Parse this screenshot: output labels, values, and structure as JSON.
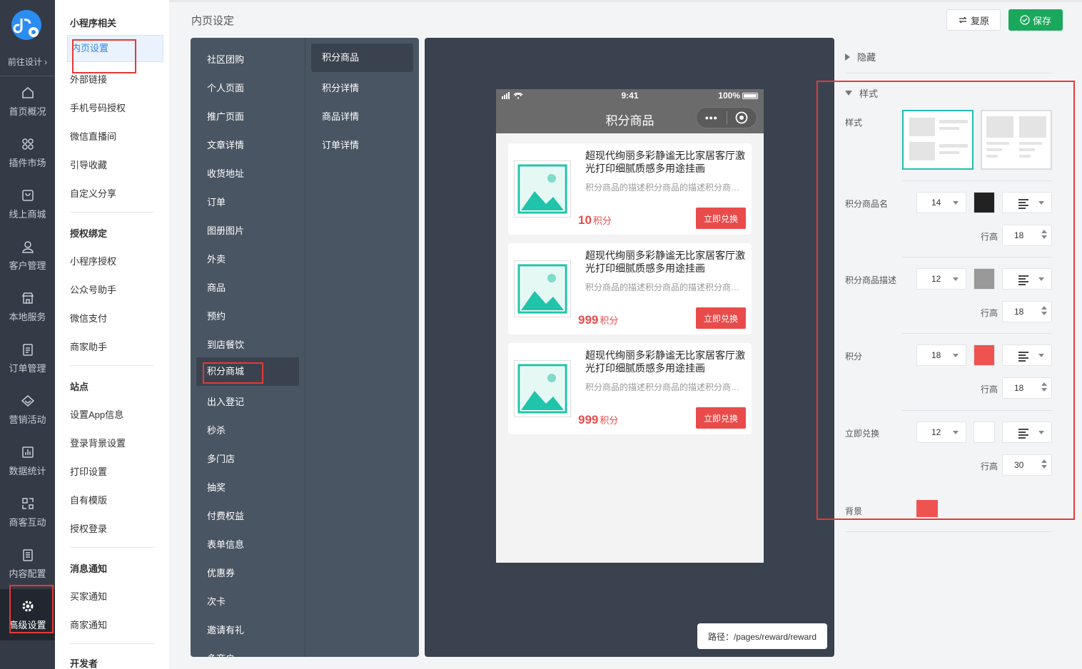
{
  "rail": {
    "design_link": "前往设计 ›",
    "items": [
      {
        "label": "首页概况",
        "icon": "home-icon"
      },
      {
        "label": "插件市场",
        "icon": "grid-icon"
      },
      {
        "label": "线上商城",
        "icon": "bag-icon"
      },
      {
        "label": "客户管理",
        "icon": "user-icon"
      },
      {
        "label": "本地服务",
        "icon": "store-icon"
      },
      {
        "label": "订单管理",
        "icon": "clipboard-icon"
      },
      {
        "label": "营销活动",
        "icon": "diamond-icon"
      },
      {
        "label": "数据统计",
        "icon": "chart-icon"
      },
      {
        "label": "商客互动",
        "icon": "interact-icon"
      },
      {
        "label": "内容配置",
        "icon": "document-icon"
      },
      {
        "label": "高级设置",
        "icon": "gear-icon",
        "active": true
      }
    ]
  },
  "menu": {
    "groups": [
      {
        "title": "小程序相关",
        "items": [
          "内页设置",
          "外部链接",
          "手机号码授权",
          "微信直播间",
          "引导收藏",
          "自定义分享"
        ]
      },
      {
        "title": "授权绑定",
        "items": [
          "小程序授权",
          "公众号助手",
          "微信支付",
          "商家助手"
        ]
      },
      {
        "title": "站点",
        "items": [
          "设置App信息",
          "登录背景设置",
          "打印设置",
          "自有模版",
          "授权登录"
        ]
      },
      {
        "title": "消息通知",
        "items": [
          "买家通知",
          "商家通知"
        ]
      },
      {
        "title": "开发者",
        "items": []
      }
    ]
  },
  "header": {
    "title": "内页设定",
    "restore_label": "复原",
    "save_label": "保存"
  },
  "pages": {
    "categories": [
      "社区团购",
      "个人页面",
      "推广页面",
      "文章详情",
      "收货地址",
      "订单",
      "图册图片",
      "外卖",
      "商品",
      "预约",
      "到店餐饮",
      "积分商城",
      "出入登记",
      "秒杀",
      "多门店",
      "抽奖",
      "付费权益",
      "表单信息",
      "优惠券",
      "次卡",
      "邀请有礼",
      "多商户"
    ],
    "active_category": "积分商城",
    "subpages": [
      "积分商品",
      "积分详情",
      "商品详情",
      "订单详情"
    ],
    "active_subpage": "积分商品"
  },
  "preview": {
    "status_time": "9:41",
    "status_battery": "100%",
    "nav_title": "积分商品",
    "capsule_dots": "•••",
    "products": [
      {
        "name": "超现代绚丽多彩静谧无比家居客厅激光打印细腻质感多用途挂画",
        "desc": "积分商品的描述积分商品的描述积分商品的描述",
        "price": "10",
        "unit": "积分",
        "button": "立即兑换"
      },
      {
        "name": "超现代绚丽多彩静谧无比家居客厅激光打印细腻质感多用途挂画",
        "desc": "积分商品的描述积分商品的描述积分商品的描述",
        "price": "999",
        "unit": "积分",
        "button": "立即兑换"
      },
      {
        "name": "超现代绚丽多彩静谧无比家居客厅激光打印细腻质感多用途挂画",
        "desc": "积分商品的描述积分商品的描述积分商品的描述",
        "price": "999",
        "unit": "积分",
        "button": "立即兑换"
      }
    ],
    "path_label": "路径：/pages/reward/reward"
  },
  "settings": {
    "hidden_label": "隐藏",
    "style_section": "样式",
    "style_label": "样式",
    "line_height_label": "行高",
    "rows": [
      {
        "label": "积分商品名",
        "size": "14",
        "color": "#222222",
        "line_height": "18"
      },
      {
        "label": "积分商品描述",
        "size": "12",
        "color": "#999999",
        "line_height": "18"
      },
      {
        "label": "积分",
        "size": "18",
        "color": "#ef5350",
        "line_height": "18"
      },
      {
        "label": "立即兑换",
        "size": "12",
        "color": "#ffffff",
        "line_height": "30"
      }
    ],
    "background_label": "背景",
    "background_color": "#ef5350"
  },
  "colors": {
    "accent_green": "#1aa85c",
    "accent_red": "#e94b4b",
    "link_blue": "#2e86e8",
    "teal": "#20c0b0"
  }
}
